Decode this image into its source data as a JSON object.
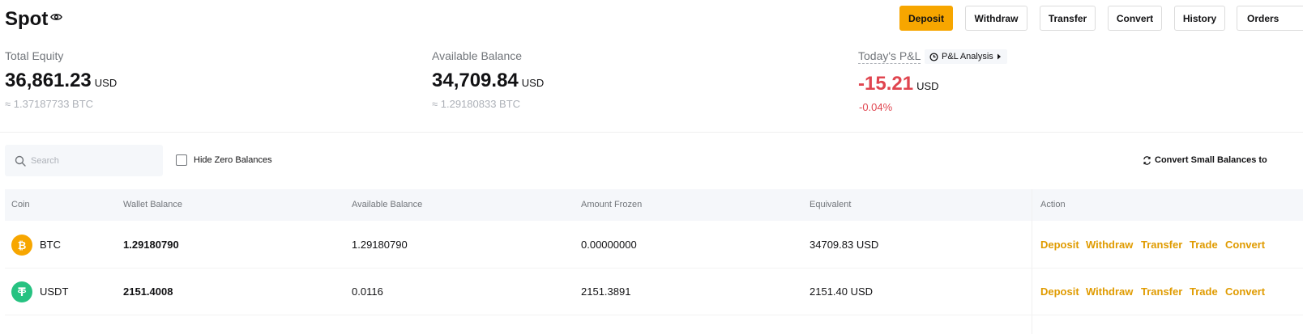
{
  "header": {
    "title": "Spot",
    "buttons": {
      "deposit": "Deposit",
      "withdraw": "Withdraw",
      "transfer": "Transfer",
      "convert": "Convert",
      "history": "History",
      "orders": "Orders"
    }
  },
  "summary": {
    "total_equity": {
      "label": "Total Equity",
      "value": "36,861.23",
      "unit": "USD",
      "btc": "≈ 1.37187733 BTC"
    },
    "available_balance": {
      "label": "Available Balance",
      "value": "34,709.84",
      "unit": "USD",
      "btc": "≈ 1.29180833 BTC"
    },
    "pnl": {
      "label": "Today's P&L",
      "analysis": "P&L Analysis",
      "value": "-15.21",
      "unit": "USD",
      "percent": "-0.04%"
    }
  },
  "toolbar": {
    "search_placeholder": "Search",
    "hide_zero": "Hide Zero Balances",
    "convert_small": "Convert Small Balances to"
  },
  "table": {
    "columns": [
      "Coin",
      "Wallet Balance",
      "Available Balance",
      "Amount Frozen",
      "Equivalent",
      "Action"
    ],
    "rows": [
      {
        "coin": "BTC",
        "wallet": "1.29180790",
        "available": "1.29180790",
        "frozen": "0.00000000",
        "equivalent": "34709.83 USD"
      },
      {
        "coin": "USDT",
        "wallet": "2151.4008",
        "available": "0.0116",
        "frozen": "2151.3891",
        "equivalent": "2151.40 USD"
      }
    ],
    "actions": [
      "Deposit",
      "Withdraw",
      "Transfer",
      "Trade",
      "Convert"
    ]
  },
  "colors": {
    "accent": "#f7a600",
    "action_link": "#e09b00",
    "loss": "#e0454f",
    "btc": "#f7a600",
    "usdt": "#26c281"
  },
  "icons": [
    "eye-icon",
    "clock-icon",
    "caret-right-icon",
    "search-icon",
    "convert-icon",
    "btc-icon",
    "usdt-icon"
  ]
}
